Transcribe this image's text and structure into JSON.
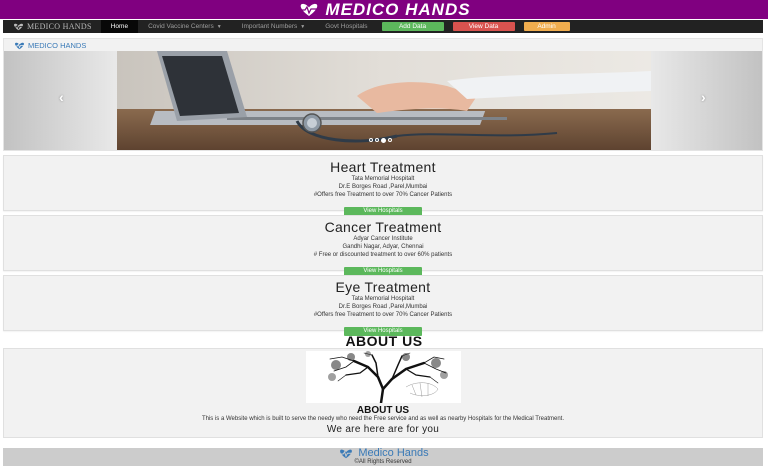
{
  "banner": {
    "title": "MEDICO HANDS"
  },
  "navbar": {
    "brand": "MEDICO HANDS",
    "items": [
      {
        "label": "Home",
        "active": true
      },
      {
        "label": "Covid Vaccine Centers",
        "dropdown": true
      },
      {
        "label": "Important Numbers",
        "dropdown": true
      },
      {
        "label": "Govt Hospitals"
      }
    ],
    "buttons": {
      "add": "Add Data",
      "view": "View Data",
      "admin": "Admin"
    }
  },
  "hero": {
    "brand": "MEDICO HANDS",
    "prev": "‹",
    "next": "›"
  },
  "cards": [
    {
      "title": "Heart Treatment",
      "hospital": "Tata Memorial Hospitalt",
      "address": "Dr.E Borges Road ,Parel,Mumbai",
      "offer": "#Offers free Treatment to over 70% Cancer Patients",
      "button": "View Hospitals"
    },
    {
      "title": "Cancer Treatment",
      "hospital": "Adyar Cancer Institute",
      "address": "Gandhi Nagar, Adyar, Chennai",
      "offer": "# Free or discounted treatment to over 60% patients",
      "button": "View Hospitals"
    },
    {
      "title": "Eye Treatment",
      "hospital": "Tata Memorial Hospitalt",
      "address": "Dr.E Borges Road ,Parel,Mumbai",
      "offer": "#Offers free Treatment to over 70% Cancer Patients",
      "button": "View Hospitals"
    }
  ],
  "about": {
    "heading": "ABOUT US",
    "subheading": "ABOUT US",
    "text": "This is a Website which is built to serve the needy who need the Free service and as well as nearby Hospitals for the Medical Treatment.",
    "tagline": "We are here are for you"
  },
  "footer": {
    "brand": "Medico Hands",
    "copyright": "©All Rights Reserved"
  },
  "colors": {
    "banner": "#800080",
    "navbar": "#222222",
    "success": "#5cb85c",
    "danger": "#d9534f",
    "warning": "#f0ad4e",
    "brand_blue": "#3a7ab7"
  }
}
